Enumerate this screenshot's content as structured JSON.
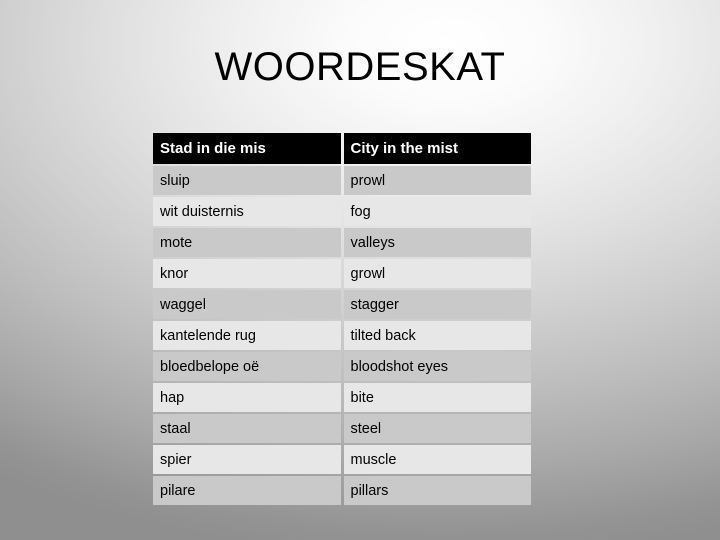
{
  "slide": {
    "title": "WOORDESKAT"
  },
  "table": {
    "headers": [
      "Stad in die mis",
      "City in the mist"
    ],
    "rows": [
      [
        "sluip",
        "prowl"
      ],
      [
        "wit duisternis",
        "fog"
      ],
      [
        "mote",
        "valleys"
      ],
      [
        "knor",
        "growl"
      ],
      [
        "waggel",
        "stagger"
      ],
      [
        "kantelende rug",
        "tilted back"
      ],
      [
        "bloedbelope oë",
        "bloodshot eyes"
      ],
      [
        "hap",
        "bite"
      ],
      [
        "staal",
        "steel"
      ],
      [
        "spier",
        "muscle"
      ],
      [
        "pilare",
        "pillars"
      ]
    ]
  },
  "colors": {
    "header_background": "#000000",
    "header_text": "#ffffff",
    "row_dark": "#c9c9c9",
    "row_light": "#e7e7e7",
    "text": "#000000"
  }
}
